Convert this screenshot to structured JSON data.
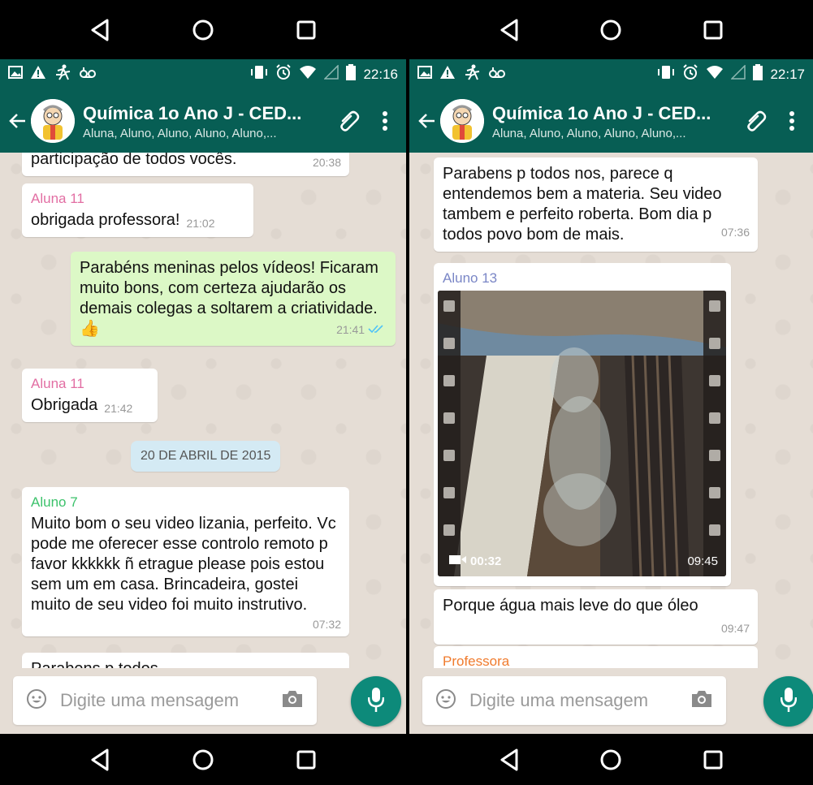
{
  "left": {
    "status": {
      "time": "22:16"
    },
    "header": {
      "title": "Química 1o Ano J - CED...",
      "subtitle": "Aluna, Aluno, Aluno, Aluno, Aluno,..."
    },
    "messages": [
      {
        "text": "participação de todos vocês.",
        "time": "20:38"
      },
      {
        "sender": "Aluna 11",
        "text": "obrigada professora!",
        "time": "21:02"
      },
      {
        "text": "Parabéns meninas pelos vídeos! Ficaram muito bons, com certeza ajudarão os demais colegas a soltarem a criatividade. 👍",
        "time": "21:41"
      },
      {
        "sender": "Aluna 11",
        "text": "Obrigada",
        "time": "21:42"
      },
      {
        "sender": "Aluno 7",
        "text": "Muito bom o seu video lizania, perfeito. Vc pode me oferecer esse controlo remoto p favor kkkkkk ñ etrague please pois estou sem um em casa. Brincadeira, gostei muito de seu video foi muito instrutivo.",
        "time": "07:32"
      },
      {
        "text": "Parabens p todos"
      }
    ],
    "date_divider": "20 DE ABRIL DE 2015",
    "input_placeholder": "Digite uma mensagem"
  },
  "right": {
    "status": {
      "time": "22:17"
    },
    "header": {
      "title": "Química 1o Ano J - CED...",
      "subtitle": "Aluna, Aluno, Aluno, Aluno, Aluno,..."
    },
    "messages": [
      {
        "text": "Parabens p todos nos, parece q entendemos bem a materia. Seu video tambem e perfeito roberta. Bom dia p todos povo bom de mais.",
        "time": "07:36"
      },
      {
        "sender": "Aluno 13",
        "video_duration": "00:32",
        "time": "09:45"
      },
      {
        "text": "Porque água mais leve do que óleo",
        "time": "09:47"
      },
      {
        "sender": "Professora"
      }
    ],
    "input_placeholder": "Digite uma mensagem"
  },
  "colors": {
    "header": "#075e54",
    "outgoing_bubble": "#dcf8c6",
    "mic": "#0d8a7a",
    "aluna_name": "#e26ea3",
    "aluno7_name": "#3cc26b",
    "aluno13_name": "#7a86c6",
    "professora_name": "#f07b2d",
    "read_ticks": "#4fc3f7"
  },
  "icons": [
    "back-icon",
    "paperclip-icon",
    "more-vert-icon",
    "emoji-icon",
    "camera-icon",
    "mic-icon",
    "nav-back-icon",
    "nav-home-icon",
    "nav-recents-icon",
    "video-camera-icon"
  ]
}
